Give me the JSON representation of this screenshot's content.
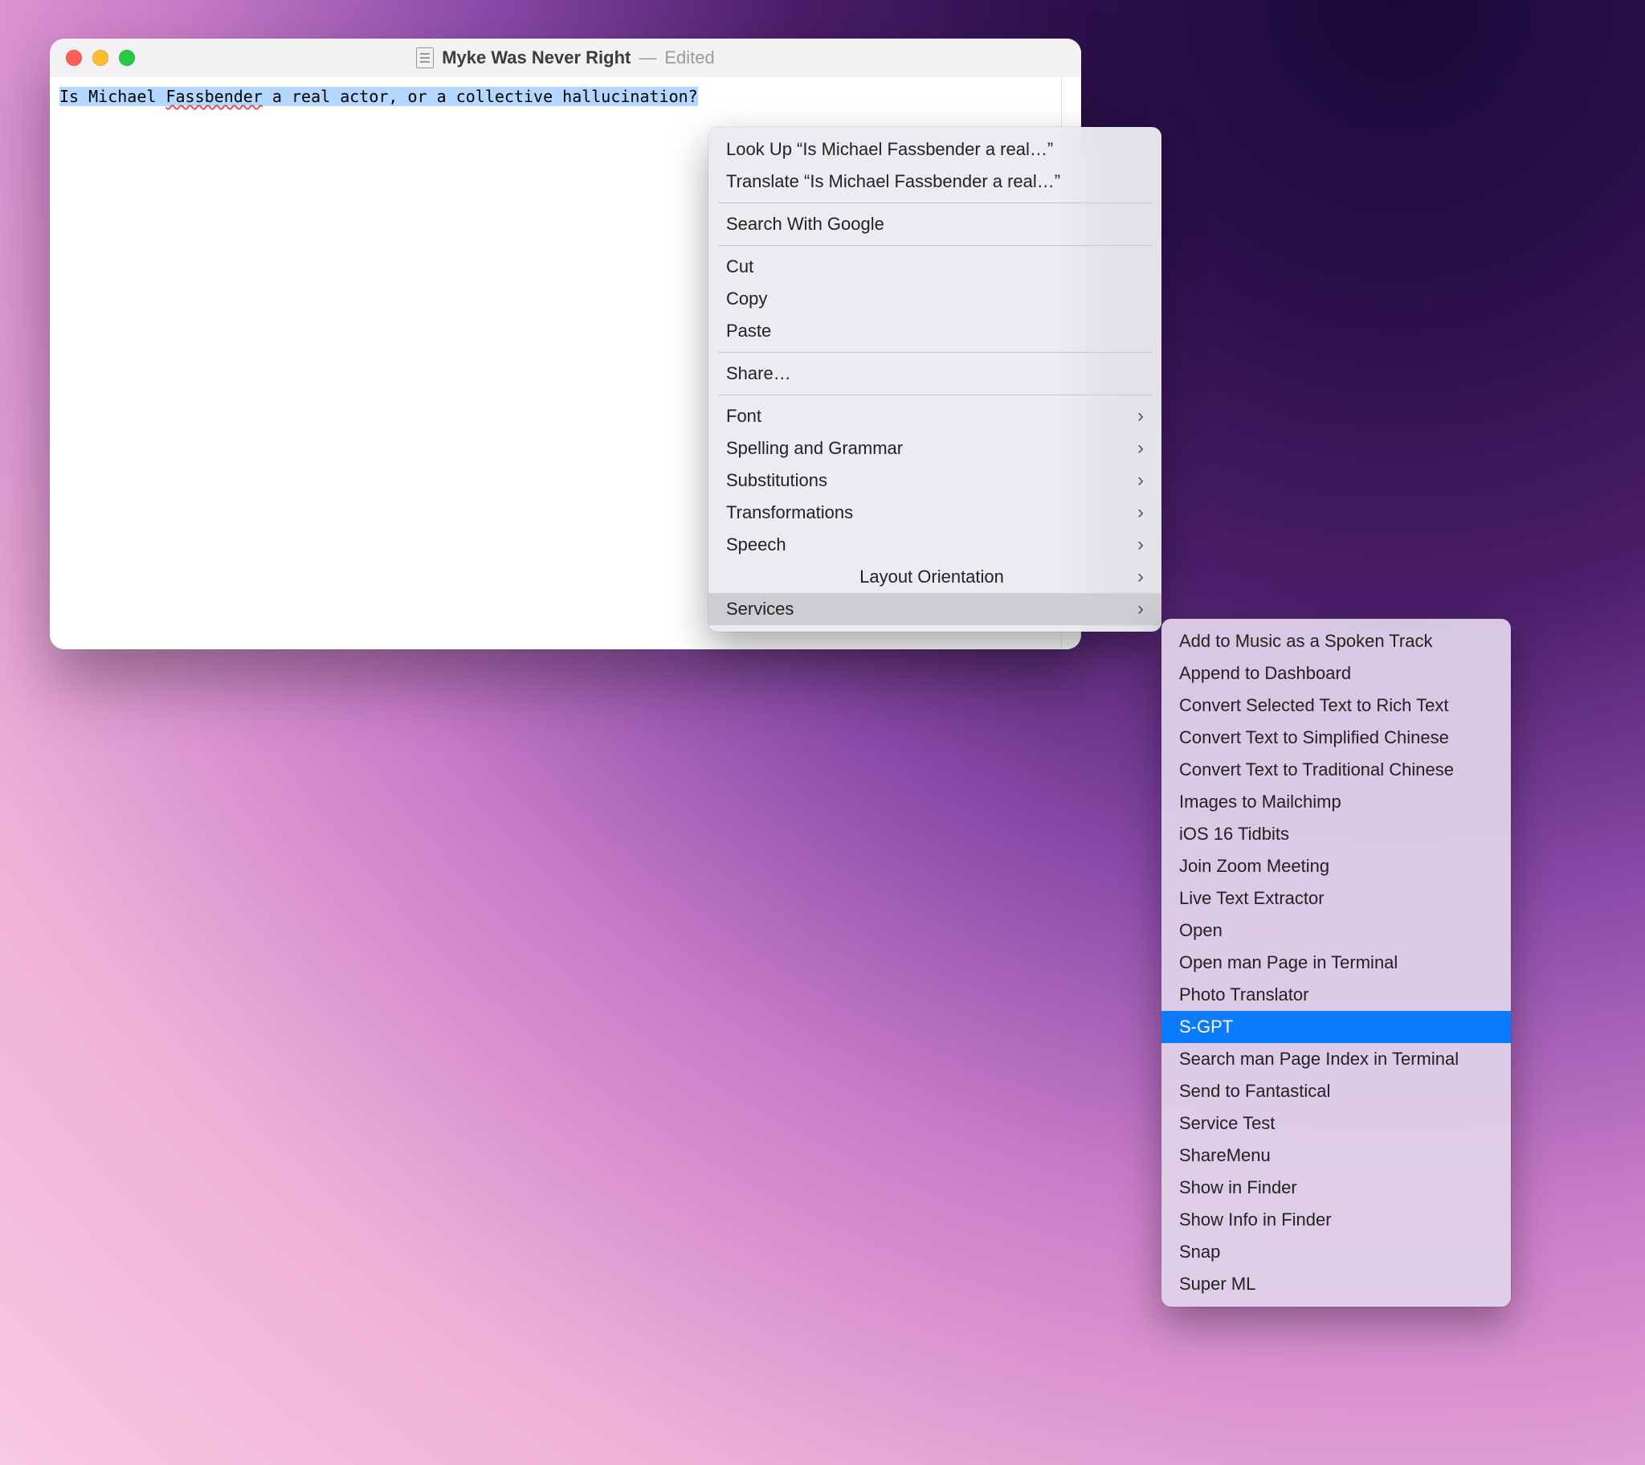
{
  "window": {
    "title": "Myke Was Never Right",
    "dash": "—",
    "status": "Edited"
  },
  "document": {
    "pre_sel": "Is Michael ",
    "sel_err": "Fassbender",
    "sel_rest": " a real actor, or a collective hallucination?"
  },
  "context_menu": {
    "lookup": "Look Up “Is Michael Fassbender a real…”",
    "translate": "Translate “Is Michael Fassbender a real…”",
    "search": "Search With Google",
    "cut": "Cut",
    "copy": "Copy",
    "paste": "Paste",
    "share": "Share…",
    "font": "Font",
    "spelling": "Spelling and Grammar",
    "subs": "Substitutions",
    "trans": "Transformations",
    "speech": "Speech",
    "layout": "Layout Orientation",
    "services": "Services"
  },
  "services_menu": {
    "items": [
      "Add to Music as a Spoken Track",
      "Append to Dashboard",
      "Convert Selected Text to Rich Text",
      "Convert Text to Simplified Chinese",
      "Convert Text to Traditional Chinese",
      "Images to Mailchimp",
      "iOS 16 Tidbits",
      "Join Zoom Meeting",
      "Live Text Extractor",
      "Open",
      "Open man Page in Terminal",
      "Photo Translator",
      "S-GPT",
      "Search man Page Index in Terminal",
      "Send to Fantastical",
      "Service Test",
      "ShareMenu",
      "Show in Finder",
      "Show Info in Finder",
      "Snap",
      "Super ML"
    ],
    "highlighted_index": 12
  }
}
